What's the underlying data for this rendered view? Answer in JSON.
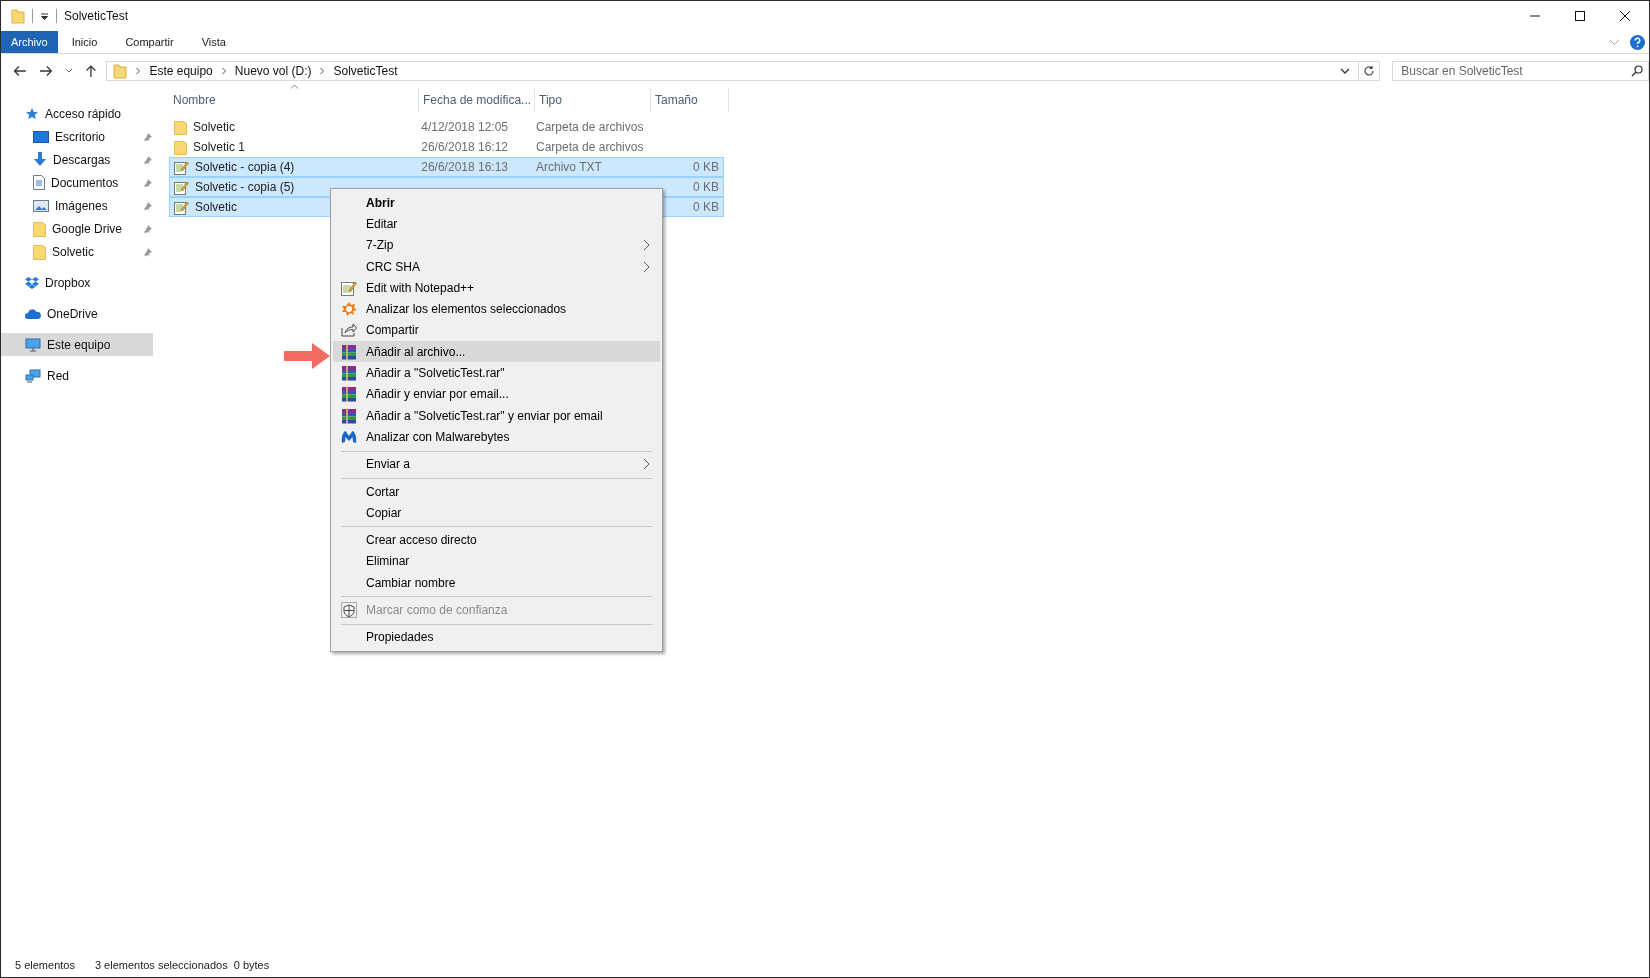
{
  "window": {
    "title": "SolveticTest"
  },
  "ribbon_tabs": [
    {
      "label": "Archivo",
      "kind": "file"
    },
    {
      "label": "Inicio",
      "kind": "tab"
    },
    {
      "label": "Compartir",
      "kind": "tab"
    },
    {
      "label": "Vista",
      "kind": "tab"
    }
  ],
  "address": {
    "crumbs": [
      "Este equipo",
      "Nuevo vol (D:)",
      "SolveticTest"
    ]
  },
  "search": {
    "placeholder": "Buscar en SolveticTest"
  },
  "sidebar": {
    "items": [
      {
        "label": "Acceso rápido",
        "kind": "star",
        "selected": false,
        "children": [
          {
            "label": "Escritorio",
            "kind": "desktop",
            "pinned": true,
            "selected": false
          },
          {
            "label": "Descargas",
            "kind": "download",
            "pinned": true,
            "selected": false
          },
          {
            "label": "Documentos",
            "kind": "document",
            "pinned": true,
            "selected": false
          },
          {
            "label": "Imágenes",
            "kind": "image",
            "pinned": true,
            "selected": false
          },
          {
            "label": "Google Drive",
            "kind": "folder",
            "pinned": true,
            "selected": false
          },
          {
            "label": "Solvetic",
            "kind": "folder",
            "pinned": true,
            "selected": false
          }
        ]
      },
      {
        "label": "Dropbox",
        "kind": "dropbox",
        "selected": false
      },
      {
        "label": "OneDrive",
        "kind": "cloud",
        "selected": false
      },
      {
        "label": "Este equipo",
        "kind": "computer",
        "selected": true
      },
      {
        "label": "Red",
        "kind": "network",
        "selected": false
      }
    ]
  },
  "table": {
    "columns": [
      "Nombre",
      "Fecha de modifica...",
      "Tipo",
      "Tamaño"
    ],
    "rows": [
      {
        "name": "Solvetic",
        "date": "4/12/2018 12:05",
        "type": "Carpeta de archivos",
        "kind": "folder",
        "selected": false
      },
      {
        "name": "Solvetic 1",
        "date": "26/6/2018 16:12",
        "type": "Carpeta de archivos",
        "kind": "folder",
        "selected": false
      },
      {
        "name": "Solvetic - copia (4)",
        "date": "26/6/2018 16:13",
        "type": "Archivo TXT",
        "size": "0 KB",
        "kind": "txt",
        "selected": true
      },
      {
        "name": "Solvetic - copia (5)",
        "size": "0 KB",
        "kind": "txt",
        "selected": true
      },
      {
        "name": "Solvetic",
        "size": "0 KB",
        "kind": "txt",
        "selected": true
      }
    ]
  },
  "context_menu": {
    "items": [
      {
        "label": "Abrir",
        "kind": "plain",
        "default": true,
        "selected": false,
        "disabled": false
      },
      {
        "label": "Editar",
        "kind": "plain",
        "default": false,
        "selected": false,
        "disabled": false
      },
      {
        "label": "7-Zip",
        "kind": "submenu",
        "default": false,
        "selected": false,
        "disabled": false
      },
      {
        "label": "CRC SHA",
        "kind": "submenu",
        "default": false,
        "selected": false,
        "disabled": false
      },
      {
        "label": "Edit with Notepad++",
        "kind": "notepad",
        "default": false,
        "selected": false,
        "disabled": false
      },
      {
        "label": "Analizar los elementos seleccionados",
        "kind": "antivirus",
        "default": false,
        "selected": false,
        "disabled": false
      },
      {
        "label": "Compartir",
        "kind": "share",
        "default": false,
        "selected": false,
        "disabled": false
      },
      {
        "label": "Añadir al archivo...",
        "kind": "archive",
        "default": false,
        "selected": true,
        "disabled": false
      },
      {
        "label": "Añadir a \"SolveticTest.rar\"",
        "kind": "archive",
        "default": false,
        "selected": false,
        "disabled": false
      },
      {
        "label": "Añadir y enviar por email...",
        "kind": "archive",
        "default": false,
        "selected": false,
        "disabled": false
      },
      {
        "label": "Añadir a \"SolveticTest.rar\" y enviar por email",
        "kind": "archive",
        "default": false,
        "selected": false,
        "disabled": false
      },
      {
        "label": "Analizar con Malwarebytes",
        "kind": "malware",
        "default": false,
        "selected": false,
        "disabled": false
      },
      {
        "kind": "separator"
      },
      {
        "label": "Enviar a",
        "kind": "submenu",
        "default": false,
        "selected": false,
        "disabled": false
      },
      {
        "kind": "separator"
      },
      {
        "label": "Cortar",
        "kind": "plain",
        "default": false,
        "selected": false,
        "disabled": false
      },
      {
        "label": "Copiar",
        "kind": "plain",
        "default": false,
        "selected": false,
        "disabled": false
      },
      {
        "kind": "separator"
      },
      {
        "label": "Crear acceso directo",
        "kind": "plain",
        "default": false,
        "selected": false,
        "disabled": false
      },
      {
        "label": "Eliminar",
        "kind": "plain",
        "default": false,
        "selected": false,
        "disabled": false
      },
      {
        "label": "Cambiar nombre",
        "kind": "plain",
        "default": false,
        "selected": false,
        "disabled": false
      },
      {
        "kind": "separator"
      },
      {
        "label": "Marcar como de confianza",
        "kind": "trust",
        "default": false,
        "selected": false,
        "disabled": true
      },
      {
        "kind": "separator"
      },
      {
        "label": "Propiedades",
        "kind": "plain",
        "default": false,
        "selected": false,
        "disabled": false
      }
    ]
  },
  "status_bar": {
    "count": "5 elementos",
    "selection": "3 elementos seleccionados  0 bytes"
  }
}
